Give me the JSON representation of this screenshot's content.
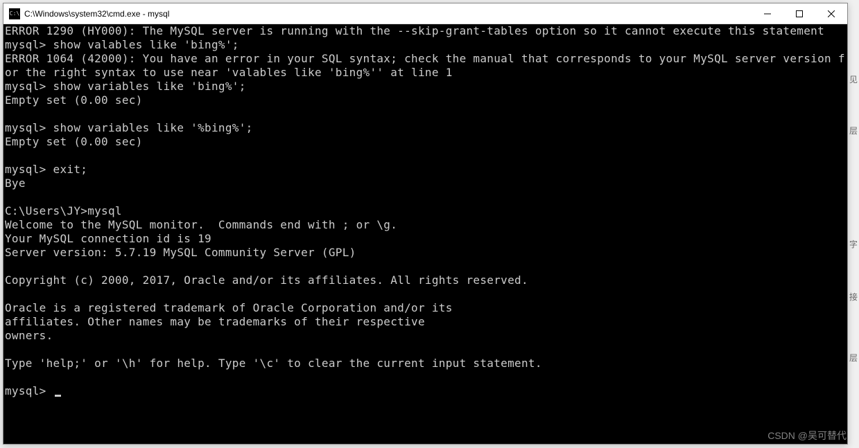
{
  "window": {
    "title": "C:\\Windows\\system32\\cmd.exe - mysql",
    "icon_label": "cmd-icon"
  },
  "terminal": {
    "lines": [
      "ERROR 1290 (HY000): The MySQL server is running with the --skip-grant-tables option so it cannot execute this statement",
      "mysql> show valables like 'bing%';",
      "ERROR 1064 (42000): You have an error in your SQL syntax; check the manual that corresponds to your MySQL server version for the right syntax to use near 'valables like 'bing%'' at line 1",
      "mysql> show variables like 'bing%';",
      "Empty set (0.00 sec)",
      "",
      "mysql> show variables like '%bing%';",
      "Empty set (0.00 sec)",
      "",
      "mysql> exit;",
      "Bye",
      "",
      "C:\\Users\\JY>mysql",
      "Welcome to the MySQL monitor.  Commands end with ; or \\g.",
      "Your MySQL connection id is 19",
      "Server version: 5.7.19 MySQL Community Server (GPL)",
      "",
      "Copyright (c) 2000, 2017, Oracle and/or its affiliates. All rights reserved.",
      "",
      "Oracle is a registered trademark of Oracle Corporation and/or its",
      "affiliates. Other names may be trademarks of their respective",
      "owners.",
      "",
      "Type 'help;' or '\\h' for help. Type '\\c' to clear the current input statement.",
      "",
      "mysql> "
    ]
  },
  "watermark": "CSDN @吴可替代",
  "bg_chars": {
    "a": "见",
    "b": "层",
    "c": "字",
    "d": "接",
    "e": "层"
  }
}
